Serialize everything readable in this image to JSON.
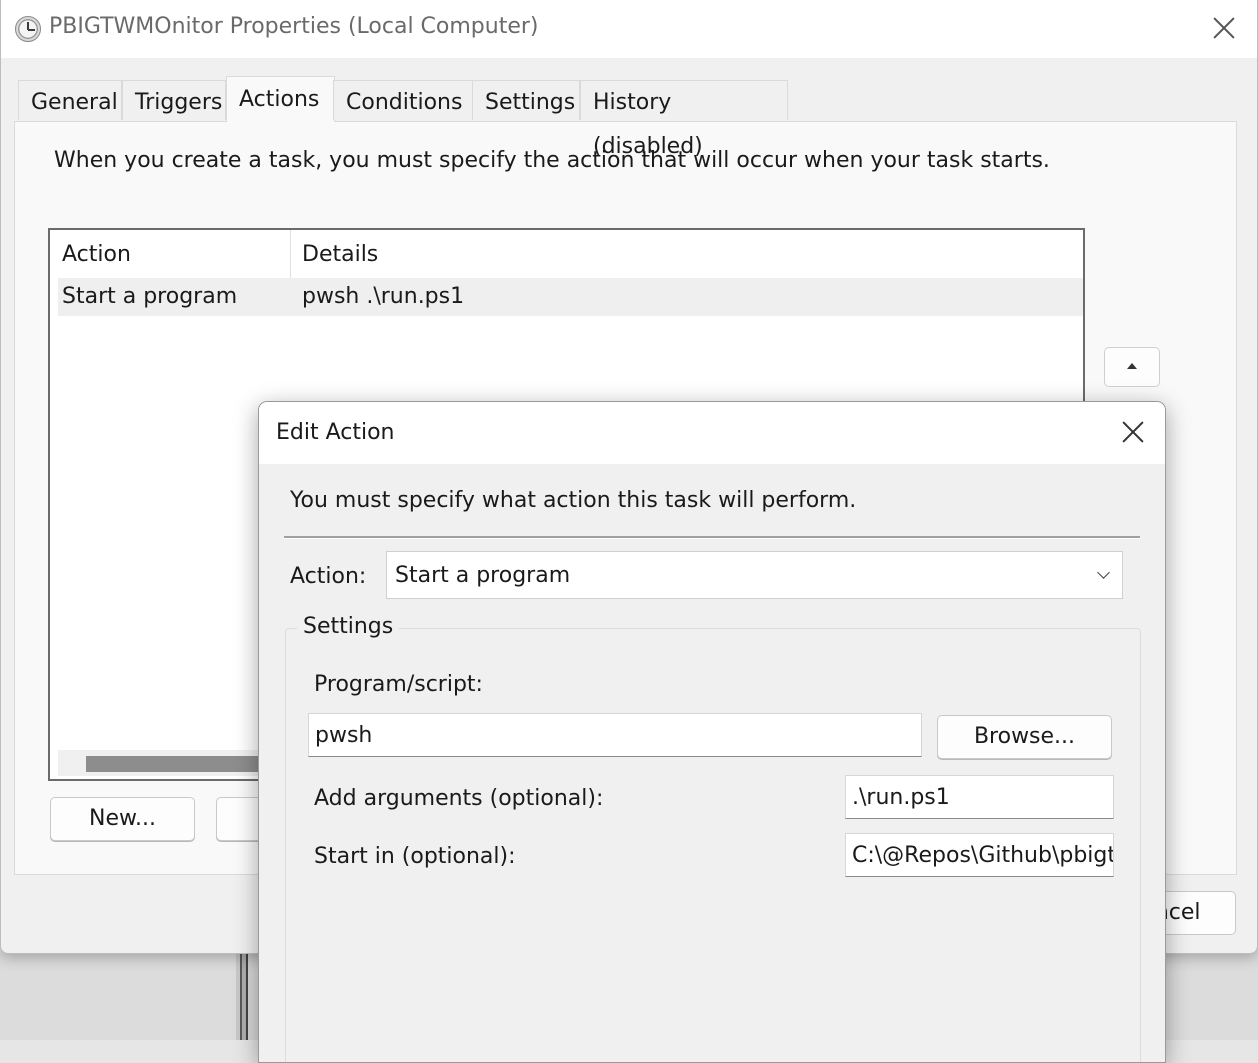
{
  "window": {
    "title": "PBIGTWMOnitor Properties (Local Computer)"
  },
  "tabs": [
    {
      "label": "General"
    },
    {
      "label": "Triggers"
    },
    {
      "label": "Actions"
    },
    {
      "label": "Conditions"
    },
    {
      "label": "Settings"
    },
    {
      "label": "History (disabled)"
    }
  ],
  "actions_tab": {
    "description": "When you create a task, you must specify the action that will occur when your task starts.",
    "columns": [
      "Action",
      "Details"
    ],
    "rows": [
      {
        "action": "Start a program",
        "details": "pwsh .\\run.ps1"
      }
    ],
    "new_button": "New...",
    "cancel_button": "Cancel"
  },
  "edit_action": {
    "title": "Edit Action",
    "description": "You must specify what action this task will perform.",
    "action_label": "Action:",
    "action_value": "Start a program",
    "settings_label": "Settings",
    "program_label": "Program/script:",
    "program_value": "pwsh",
    "browse_button": "Browse...",
    "arguments_label": "Add arguments (optional):",
    "arguments_value": ".\\run.ps1",
    "start_in_label": "Start in (optional):",
    "start_in_value": "C:\\@Repos\\Github\\pbigtwmonitor"
  }
}
